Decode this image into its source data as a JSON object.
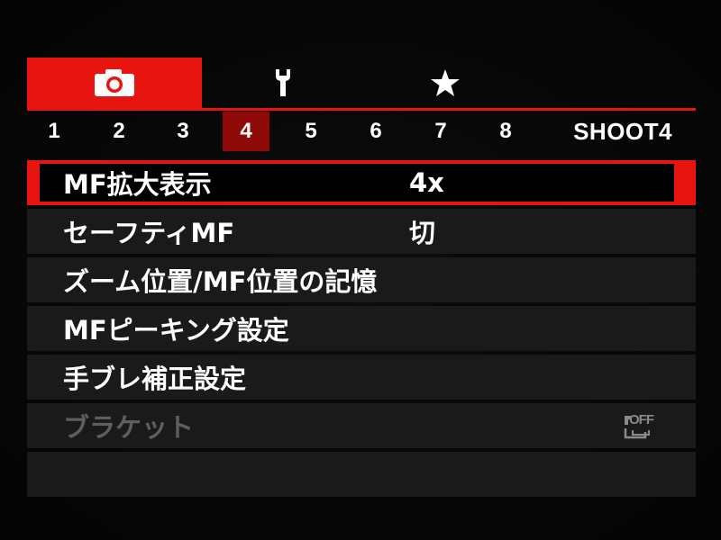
{
  "top_tabs": [
    {
      "icon": "camera-icon",
      "active": true
    },
    {
      "icon": "wrench-icon",
      "active": false
    },
    {
      "icon": "star-icon",
      "active": false
    }
  ],
  "sub_tabs": [
    "1",
    "2",
    "3",
    "4",
    "5",
    "6",
    "7",
    "8"
  ],
  "active_sub_tab": "4",
  "sub_title": "SHOOT4",
  "menu": {
    "items": [
      {
        "label": "MF拡大表示",
        "value": "4x"
      },
      {
        "label": "セーフティMF",
        "value": "切"
      },
      {
        "label": "ズーム位置/MF位置の記憶",
        "value": ""
      },
      {
        "label": "MFピーキング設定",
        "value": ""
      },
      {
        "label": "手ブレ補正設定",
        "value": ""
      },
      {
        "label": "ブラケット",
        "value": "",
        "icon": "bracket-off-icon",
        "icon_text": "OFF"
      }
    ]
  },
  "colors": {
    "accent": "#e8140f",
    "active_sub_tab": "#8e0b08",
    "row_bg": "#1a1a1a",
    "disabled_text": "#5e5e5e"
  }
}
